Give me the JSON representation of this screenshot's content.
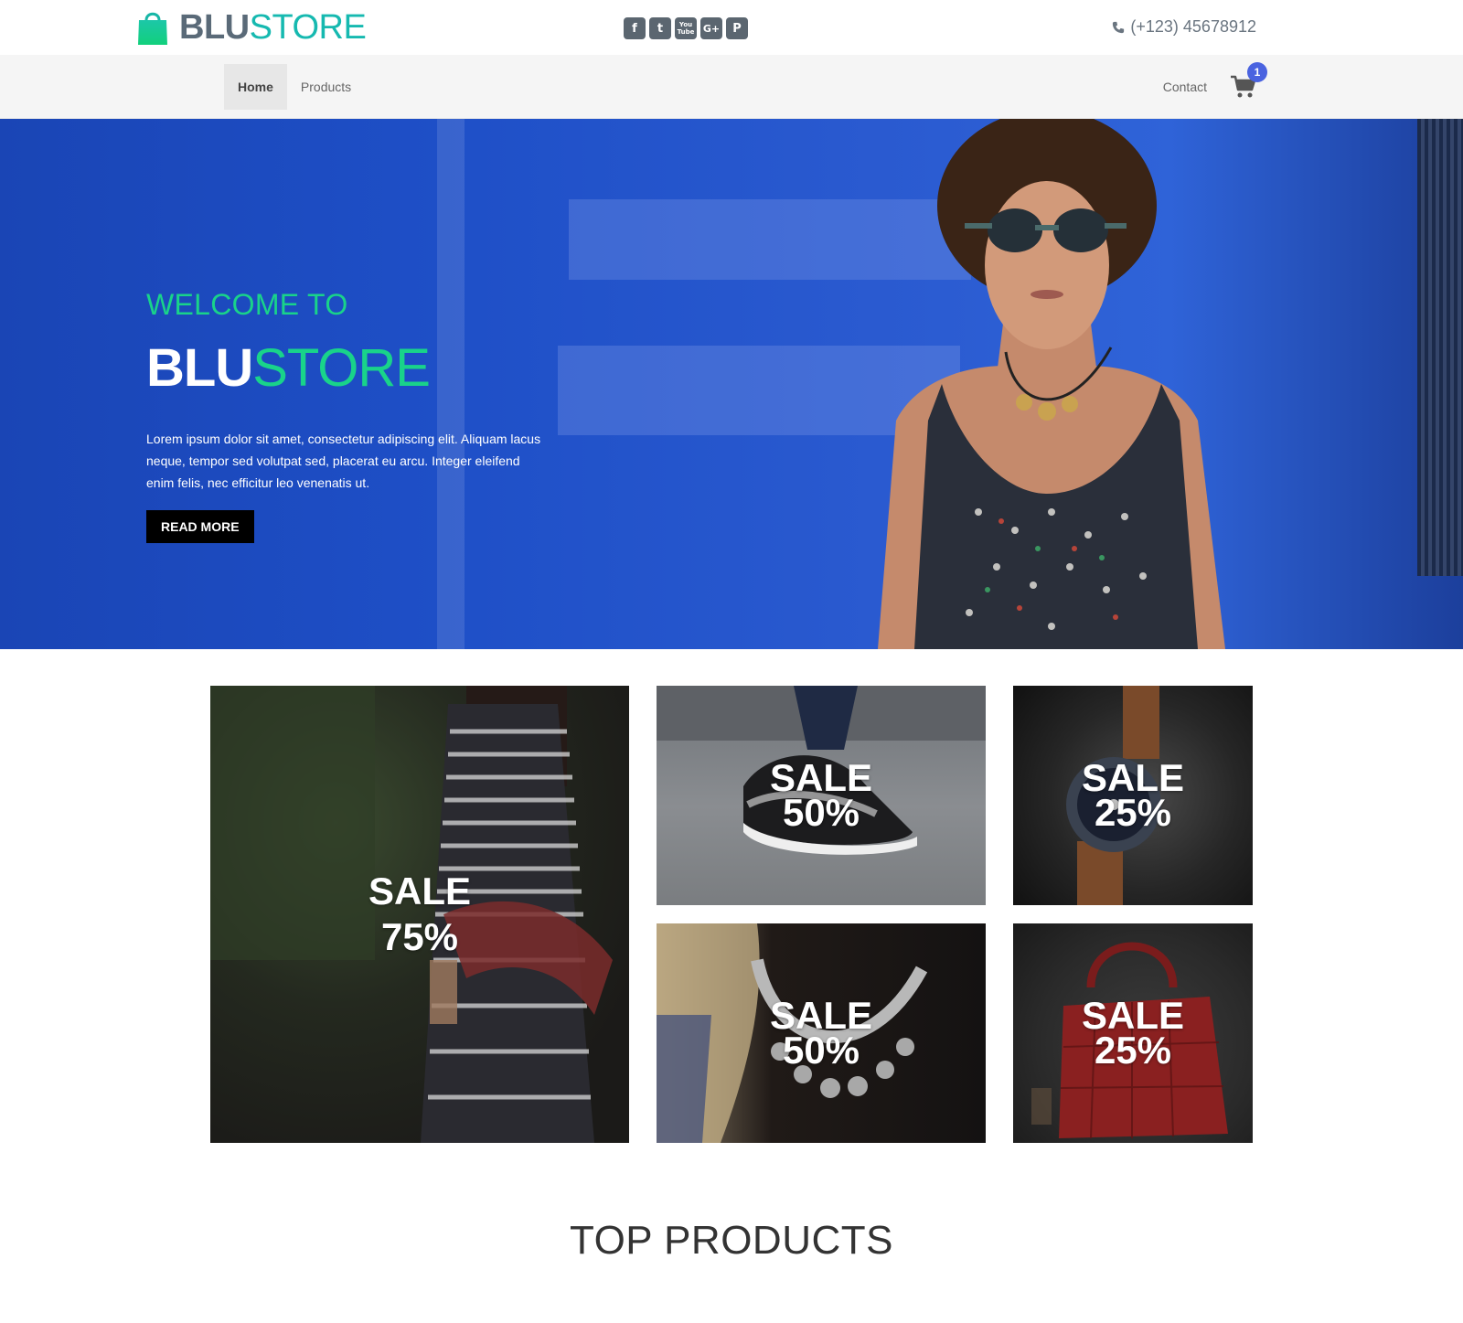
{
  "brand": {
    "name_part1": "BLU",
    "name_part2": "STORE",
    "accent": "#16b9b0"
  },
  "header": {
    "socials": [
      {
        "icon": "facebook-icon",
        "glyph": "f"
      },
      {
        "icon": "twitter-icon",
        "glyph": "t"
      },
      {
        "icon": "youtube-icon",
        "glyph_top": "You",
        "glyph_bottom": "Tube"
      },
      {
        "icon": "google-plus-icon",
        "glyph": "G+"
      },
      {
        "icon": "pinterest-icon",
        "glyph": "P"
      }
    ],
    "phone": "(+123) 45678912"
  },
  "nav": {
    "items": [
      {
        "label": "Home",
        "active": true
      },
      {
        "label": "Products",
        "active": false
      }
    ],
    "contact": "Contact",
    "cart_count": "1"
  },
  "hero": {
    "welcome": "WELCOME TO",
    "title_part1": "BLU",
    "title_part2": "STORE",
    "text": "Lorem ipsum dolor sit amet, consectetur adipiscing elit. Aliquam lacus neque, tempor sed volutpat sed, placerat eu arcu. Integer eleifend enim felis, nec efficitur leo venenatis ut.",
    "button": "READ MORE",
    "accent": "#19d38a"
  },
  "sales": [
    {
      "line1": "SALE",
      "line2": "75%"
    },
    {
      "line1": "SALE",
      "line2": "50%"
    },
    {
      "line1": "SALE",
      "line2": "25%"
    },
    {
      "line1": "SALE",
      "line2": "50%"
    },
    {
      "line1": "SALE",
      "line2": "25%"
    }
  ],
  "top_products": {
    "title": "TOP PRODUCTS"
  }
}
